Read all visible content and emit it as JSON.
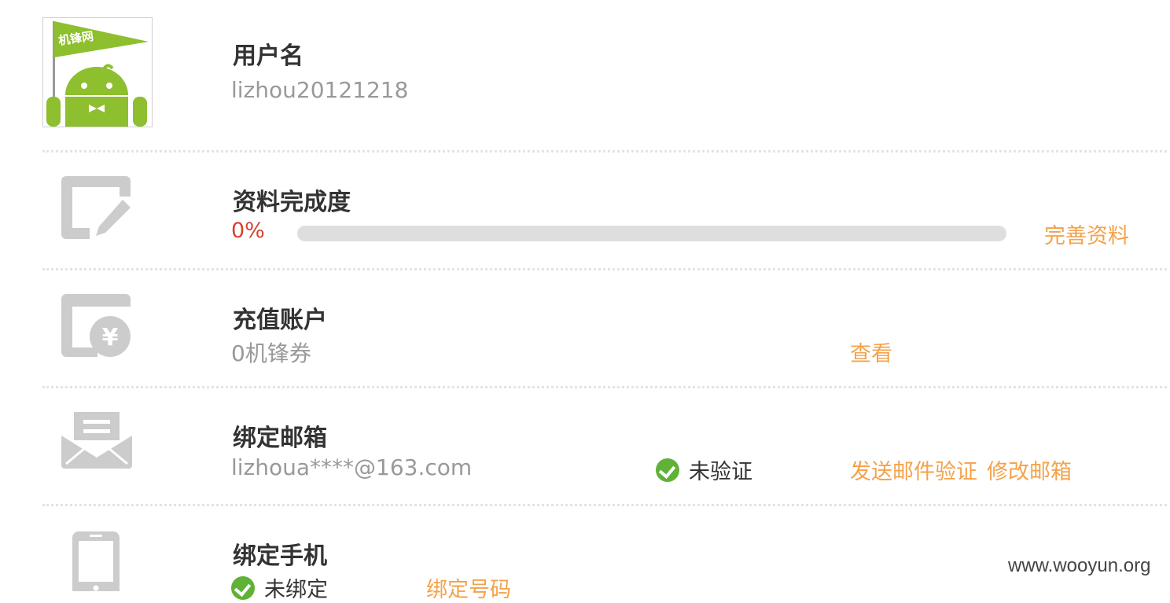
{
  "user": {
    "avatar_text": "机锋网",
    "name_label": "用户名",
    "username": "lizhou20121218"
  },
  "profile": {
    "title": "资料完成度",
    "percent_text": "0%",
    "progress": 0,
    "action": "完善资料"
  },
  "account": {
    "title": "充值账户",
    "balance": "0机锋券",
    "action": "查看"
  },
  "email": {
    "title": "绑定邮箱",
    "value": "lizhoua****@163.com",
    "status": "未验证",
    "action_send": "发送邮件验证",
    "action_modify": "修改邮箱"
  },
  "phone": {
    "title": "绑定手机",
    "status": "未绑定",
    "action": "绑定号码"
  },
  "watermark": "www.wooyun.org",
  "colors": {
    "accent": "#f4a24a",
    "percent": "#d9412d",
    "check": "#5fb236",
    "icon": "#cccccc",
    "android": "#8dbf2e"
  },
  "icons": {
    "profile": "edit-icon",
    "account": "wallet-yen-icon",
    "email": "envelope-icon",
    "phone": "phone-icon"
  }
}
